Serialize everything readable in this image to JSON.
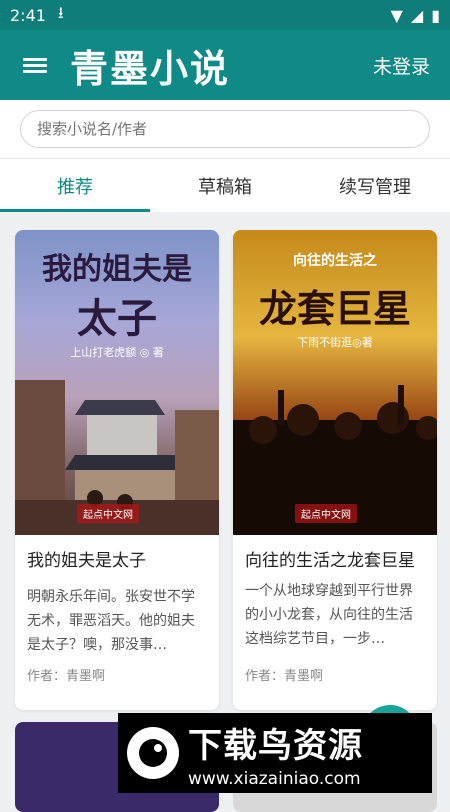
{
  "status": {
    "time": "2:41"
  },
  "appbar": {
    "title": "青墨小说",
    "login": "未登录"
  },
  "search": {
    "placeholder": "搜索小说名/作者"
  },
  "tabs": [
    {
      "label": "推荐"
    },
    {
      "label": "草稿箱"
    },
    {
      "label": "续写管理"
    }
  ],
  "books": [
    {
      "cover_title_line1": "我的姐夫是",
      "cover_title_line2": "太子",
      "cover_author": "上山打老虎额 ◎ 著",
      "publisher": "起点中文网",
      "title": "我的姐夫是太子",
      "desc": "明朝永乐年间。张安世不学无术，罪恶滔天。他的姐夫是太子？噢，那没事…",
      "author": "作者：青墨啊"
    },
    {
      "cover_top": "向往的生活之",
      "cover_title": "龙套巨星",
      "cover_author": "下雨不街逛◎著",
      "publisher": "起点中文网",
      "title": "向往的生活之龙套巨星",
      "desc": "一个从地球穿越到平行世界的小小龙套，从向往的生活这档综艺节目，一步…",
      "author": "作者：青墨啊"
    }
  ],
  "watermark": {
    "main": "下载鸟资源",
    "url": "www.xiazainiao.com"
  }
}
